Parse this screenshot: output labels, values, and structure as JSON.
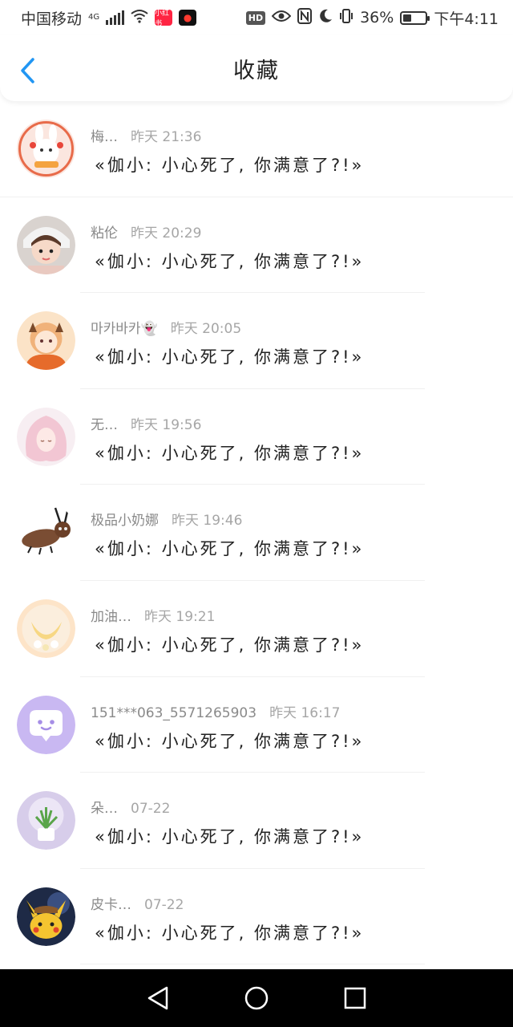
{
  "status_bar": {
    "carrier": "中国移动",
    "network": "4G",
    "app_badge_1": "小红书",
    "app_badge_2": "●",
    "hd": "HD",
    "battery_percent": "36%",
    "battery_level": 0.36,
    "time": "下午4:11"
  },
  "header": {
    "title": "收藏",
    "back_icon": "chevron-left-icon"
  },
  "items": [
    {
      "name": "梅…",
      "time": "昨天 21:36",
      "message": "«伽小: 小心死了, 你满意了?!»",
      "avatar_icon": "bunny-avatar"
    },
    {
      "name": "粘伦",
      "time": "昨天 20:29",
      "message": "«伽小: 小心死了, 你满意了?!»",
      "avatar_icon": "girl-avatar"
    },
    {
      "name": "마카바카👻",
      "time": "昨天 20:05",
      "message": "«伽小: 小心死了, 你满意了?!»",
      "avatar_icon": "anime-girl-avatar"
    },
    {
      "name": "无…",
      "time": "昨天 19:56",
      "message": "«伽小: 小心死了, 你满意了?!»",
      "avatar_icon": "pink-hair-avatar"
    },
    {
      "name": "极品小奶娜",
      "time": "昨天 19:46",
      "message": "«伽小: 小心死了, 你满意了?!»",
      "avatar_icon": "bug-avatar"
    },
    {
      "name": "加油…",
      "time": "昨天 19:21",
      "message": "«伽小: 小心死了, 你满意了?!»",
      "avatar_icon": "moon-avatar"
    },
    {
      "name": "151***063_5571265903",
      "time": "昨天 16:17",
      "message": "«伽小: 小心死了, 你满意了?!»",
      "avatar_icon": "chat-bubble-avatar"
    },
    {
      "name": "朵…",
      "time": "07-22",
      "message": "«伽小: 小心死了, 你满意了?!»",
      "avatar_icon": "plant-avatar"
    },
    {
      "name": "皮卡…",
      "time": "07-22",
      "message": "«伽小: 小心死了, 你满意了?!»",
      "avatar_icon": "pikachu-avatar"
    }
  ],
  "nav_bar": {
    "back": "triangle-back-icon",
    "home": "circle-home-icon",
    "recents": "square-recents-icon"
  },
  "colors": {
    "accent": "#2196f3",
    "name_text": "#8a8a8a",
    "time_text": "#a6a6a6",
    "message_text": "#222222"
  }
}
